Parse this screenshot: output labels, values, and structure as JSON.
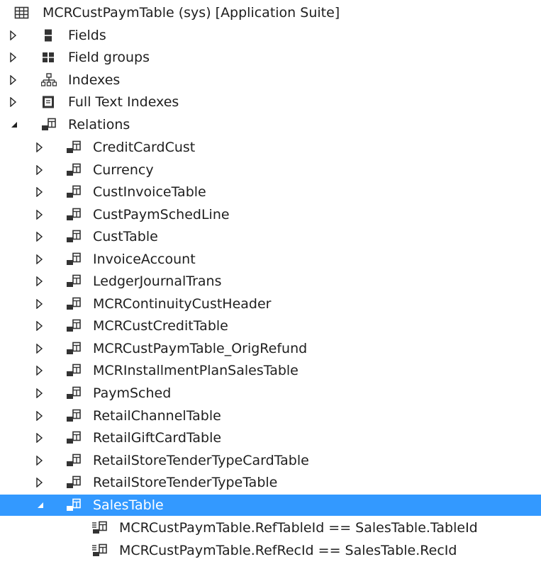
{
  "tree": {
    "root": {
      "label": "MCRCustPaymTable (sys) [Application Suite]",
      "icon": "table-icon"
    },
    "nodes": [
      {
        "label": "Fields",
        "icon": "fields-icon",
        "expanded": false
      },
      {
        "label": "Field groups",
        "icon": "field-groups-icon",
        "expanded": false
      },
      {
        "label": "Indexes",
        "icon": "indexes-icon",
        "expanded": false
      },
      {
        "label": "Full Text Indexes",
        "icon": "full-text-index-icon",
        "expanded": false
      },
      {
        "label": "Relations",
        "icon": "relation-icon",
        "expanded": true
      }
    ],
    "relations": [
      {
        "label": "CreditCardCust",
        "icon": "relation-icon"
      },
      {
        "label": "Currency",
        "icon": "relation-icon"
      },
      {
        "label": "CustInvoiceTable",
        "icon": "relation-icon"
      },
      {
        "label": "CustPaymSchedLine",
        "icon": "relation-icon"
      },
      {
        "label": "CustTable",
        "icon": "relation-icon"
      },
      {
        "label": "InvoiceAccount",
        "icon": "relation-icon"
      },
      {
        "label": "LedgerJournalTrans",
        "icon": "relation-icon"
      },
      {
        "label": "MCRContinuityCustHeader",
        "icon": "relation-icon"
      },
      {
        "label": "MCRCustCreditTable",
        "icon": "relation-icon"
      },
      {
        "label": "MCRCustPaymTable_OrigRefund",
        "icon": "relation-icon"
      },
      {
        "label": "MCRInstallmentPlanSalesTable",
        "icon": "relation-icon"
      },
      {
        "label": "PaymSched",
        "icon": "relation-icon"
      },
      {
        "label": "RetailChannelTable",
        "icon": "relation-icon"
      },
      {
        "label": "RetailGiftCardTable",
        "icon": "relation-icon"
      },
      {
        "label": "RetailStoreTenderTypeCardTable",
        "icon": "relation-icon"
      },
      {
        "label": "RetailStoreTenderTypeTable",
        "icon": "relation-icon"
      },
      {
        "label": "SalesTable",
        "icon": "relation-icon",
        "expanded": true,
        "selected": true
      }
    ],
    "constraints": [
      {
        "label": "MCRCustPaymTable.RefTableId == SalesTable.TableId",
        "icon": "relation-constraint-icon"
      },
      {
        "label": "MCRCustPaymTable.RefRecId == SalesTable.RecId",
        "icon": "relation-constraint-icon"
      }
    ],
    "colors": {
      "selection": "#3399ff",
      "text": "#1e1e1e",
      "selected_text": "#ffffff"
    }
  }
}
